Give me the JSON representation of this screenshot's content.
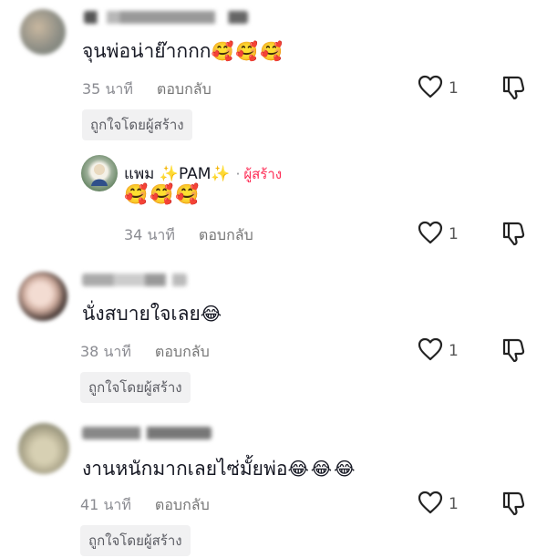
{
  "comments": [
    {
      "text": "จุนพ่อน่าย๊ากกก",
      "emojis": "🥰🥰🥰",
      "time": "35 นาที",
      "reply_label": "ตอบกลับ",
      "likes": "1",
      "creator_liked_label": "ถูกใจโดยผู้สร้าง",
      "reply": {
        "author": "แพม ✨PAM✨",
        "separator": "·",
        "creator_tag": "ผู้สร้าง",
        "emojis": "🥰🥰🥰",
        "time": "34 นาที",
        "reply_label": "ตอบกลับ",
        "likes": "1"
      }
    },
    {
      "text": "นั่งสบายใจเลย",
      "emojis": "😂",
      "time": "38 นาที",
      "reply_label": "ตอบกลับ",
      "likes": "1",
      "creator_liked_label": "ถูกใจโดยผู้สร้าง"
    },
    {
      "text": "งานหนักมากเลยไซ่มั้ยพ่อ",
      "emojis": "😂😂😂",
      "time": "41 นาที",
      "reply_label": "ตอบกลับ",
      "likes": "1",
      "creator_liked_label": "ถูกใจโดยผู้สร้าง"
    }
  ],
  "icons": {
    "like": "heart-outline-icon",
    "dislike": "thumb-down-outline-icon"
  },
  "colors": {
    "creator_accent": "#fe2c55",
    "meta_gray": "#8a8b91"
  }
}
